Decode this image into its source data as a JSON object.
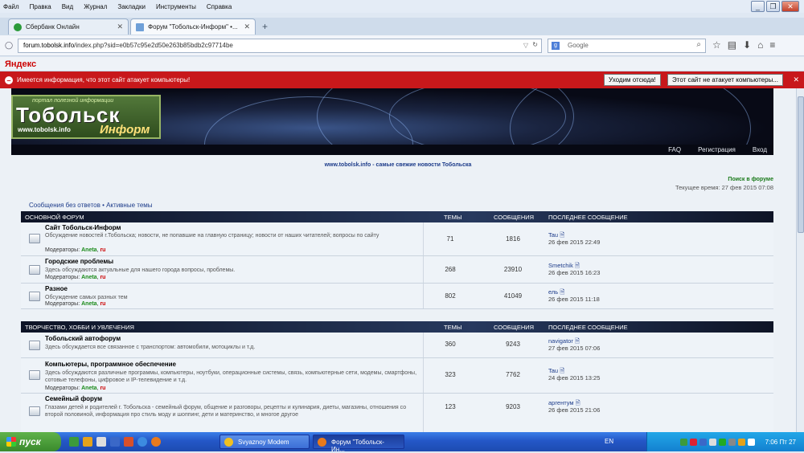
{
  "menu": [
    "Файл",
    "Правка",
    "Вид",
    "Журнал",
    "Закладки",
    "Инструменты",
    "Справка"
  ],
  "tabs": [
    {
      "label": "Сбербанк Онлайн",
      "favicon_color": "#2a9a3a"
    },
    {
      "label": "Форум \"Тобольск-Информ\" •...",
      "favicon_color": "#6fa0d8"
    }
  ],
  "url": {
    "host": "forum.tobolsk.info",
    "path": "/index.php?sid=e0b57c95e2d50e263b85bdb2c97714be"
  },
  "search_placeholder": "Google",
  "yandex_label": "Яндекс",
  "warning": {
    "text": "Имеется информация, что этот сайт атакует компьютеры!",
    "leave_button": "Уходим отсюда!",
    "not_attack_button": "Этот сайт не атакует компьютеры..."
  },
  "logo": {
    "top": "портал полезной информации",
    "main": "Тобольск",
    "url": "www.tobolsk.info",
    "script": "Информ"
  },
  "header_nav": [
    "FAQ",
    "Регистрация",
    "Вход"
  ],
  "tagline": "www.tobolsk.info - самые свежие новости Тобольска",
  "forum_search": "Поиск в форуме",
  "current_time": "Текущее время: 27 фев 2015 07:08",
  "quick_links": "Сообщения без ответов • Активные темы",
  "columns": {
    "topics": "ТЕМЫ",
    "posts": "СООБЩЕНИЯ",
    "last": "ПОСЛЕДНЕЕ СООБЩЕНИЕ"
  },
  "moderators_label": "Модераторы:",
  "sections": [
    {
      "title": "ОСНОВНОЙ ФОРУМ",
      "forums": [
        {
          "name": "Сайт Тобольск-Информ",
          "desc": "Обсуждение новостей г.Тобольска; новости, не попавшие на главную страницу; новости от наших читателей; вопросы по сайту",
          "mods": [
            "Aneta",
            "ru"
          ],
          "topics": "71",
          "posts": "1816",
          "last_user": "Tau",
          "last_date": "26 фев 2015 22:49"
        },
        {
          "name": "Городские проблемы",
          "desc": "Здесь обсуждаются актуальные для нашего города вопросы, проблемы.",
          "mods": [
            "Aneta",
            "ru"
          ],
          "topics": "268",
          "posts": "23910",
          "last_user": "Smetchik",
          "last_date": "26 фев 2015 16:23"
        },
        {
          "name": "Разное",
          "desc": "Обсуждение самых разных тем",
          "mods": [
            "Aneta",
            "ru"
          ],
          "topics": "802",
          "posts": "41049",
          "last_user": "ель",
          "last_date": "26 фев 2015 11:18"
        }
      ]
    },
    {
      "title": "ТВОРЧЕСТВО, ХОББИ И УВЛЕЧЕНИЯ",
      "forums": [
        {
          "name": "Тобольский автофорум",
          "desc": "Здесь обсуждается все связанное с транспортом: автомобили, мотоциклы и т.д.",
          "mods": [],
          "topics": "360",
          "posts": "9243",
          "last_user": "navigator",
          "last_date": "27 фев 2015 07:06"
        },
        {
          "name": "Компьютеры, программное обеспечение",
          "desc": "Здесь обсуждаются различные программы, компьютеры, ноутбуки, операционные системы, связь, компьютерные сети, модемы, смартфоны, сотовые телефоны, цифровое и IP-телевидение и т.д.",
          "mods": [
            "Aneta",
            "ru"
          ],
          "topics": "323",
          "posts": "7762",
          "last_user": "Tau",
          "last_date": "24 фев 2015 13:25"
        },
        {
          "name": "Семейный форум",
          "desc": "Глазами детей и родителей г. Тобольска - семейный форум, общение и разговоры, рецепты и кулинария, диеты, магазины, отношения со второй половиной, информация про стиль моду и шоппинг, дети и материнство, и многое другое",
          "mods": [],
          "topics": "123",
          "posts": "9203",
          "last_user": "аргентум",
          "last_date": "26 фев 2015 21:06"
        }
      ]
    }
  ],
  "taskbar": {
    "start": "пуск",
    "windows": [
      "Svyaznoy Modem",
      "Форум \"Тобольск-Ин..."
    ],
    "lang": "EN",
    "clock": "7:06 Пт 27"
  }
}
